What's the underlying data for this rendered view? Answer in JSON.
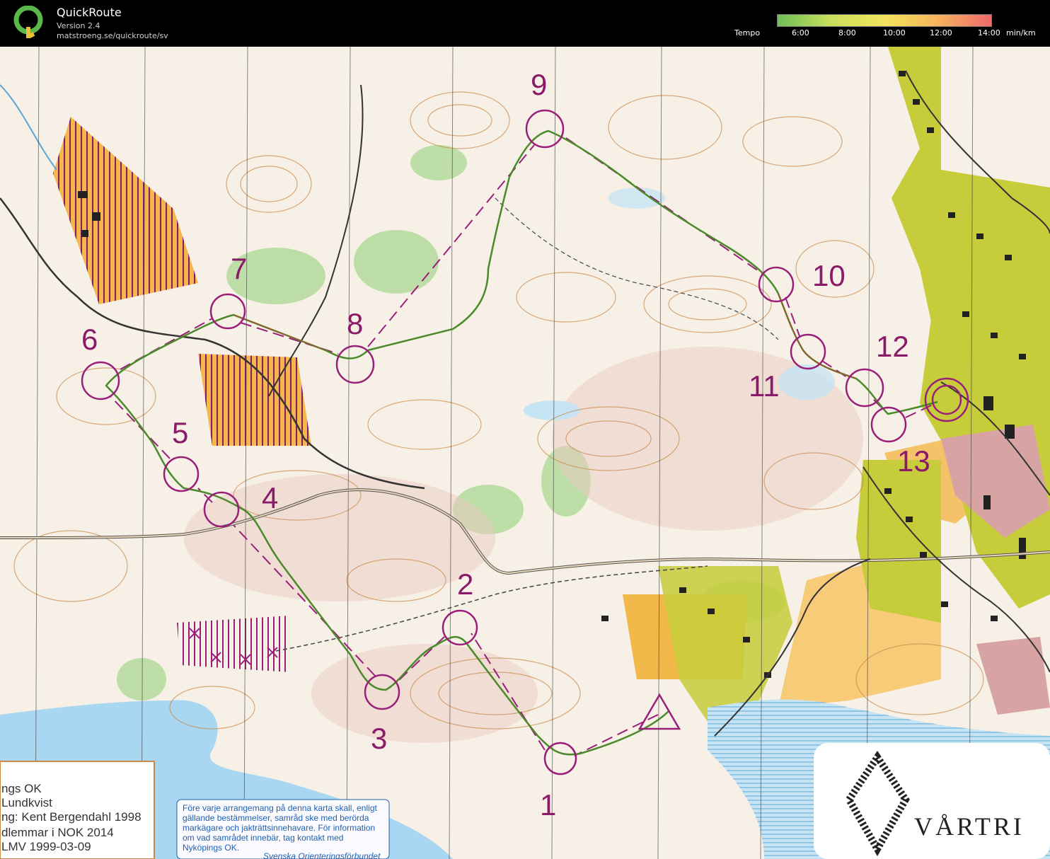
{
  "app": {
    "name": "QuickRoute",
    "version": "Version 2.4",
    "url": "matstroeng.se/quickroute/sv"
  },
  "pace_legend": {
    "label": "Tempo",
    "ticks": [
      "6:00",
      "8:00",
      "10:00",
      "12:00",
      "14:00"
    ],
    "unit": "min/km",
    "colors": [
      "#6fbf5a",
      "#c9df5c",
      "#f2e35c",
      "#f6b35e",
      "#ee6b6b"
    ]
  },
  "map": {
    "colors": {
      "course": "#9a1f7a",
      "route": "#4a8a2a",
      "forest_light": "#f7f2ea",
      "open_land": "#f2b84a",
      "green_vegetation": "#8fcf74",
      "water": "#a9d6f0",
      "settlement": "#c7cc3a",
      "contour": "#c9894a"
    },
    "control_numbers": [
      "1",
      "2",
      "3",
      "4",
      "5",
      "6",
      "7",
      "8",
      "9",
      "10",
      "11",
      "12",
      "13"
    ],
    "info_box_lines": [
      "ngs OK",
      "Lundkvist",
      "ng: Kent Bergendahl 1998",
      "dlemmar i NOK 2014",
      "LMV  1999-03-09"
    ],
    "notice_lines": [
      "Före varje arrangemang på denna karta skall, enligt",
      "gällande bestämmelser,  samråd ske  med  berörda",
      "markägare och jakträttsinnehavare. För information",
      "om vad samrådet innebär, tag kontakt med",
      "Nyköpings OK.",
      "Svenska Orienteringsförbundet"
    ],
    "brand_text": "VÅRTRI"
  }
}
